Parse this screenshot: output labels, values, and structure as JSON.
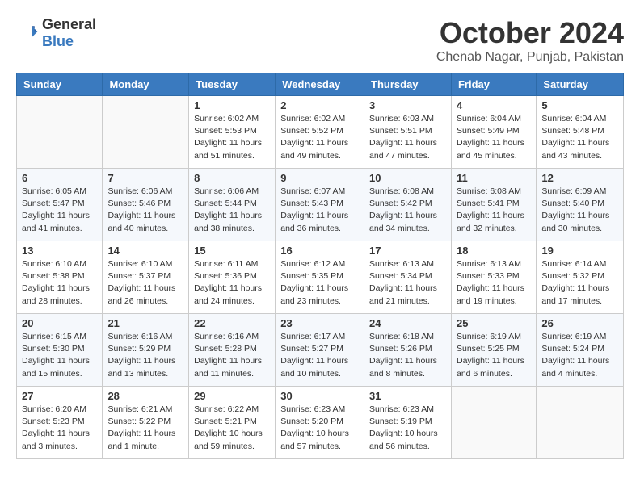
{
  "header": {
    "logo_general": "General",
    "logo_blue": "Blue",
    "month": "October 2024",
    "location": "Chenab Nagar, Punjab, Pakistan"
  },
  "days_of_week": [
    "Sunday",
    "Monday",
    "Tuesday",
    "Wednesday",
    "Thursday",
    "Friday",
    "Saturday"
  ],
  "weeks": [
    [
      {
        "day": "",
        "info": ""
      },
      {
        "day": "",
        "info": ""
      },
      {
        "day": "1",
        "info": "Sunrise: 6:02 AM\nSunset: 5:53 PM\nDaylight: 11 hours and 51 minutes."
      },
      {
        "day": "2",
        "info": "Sunrise: 6:02 AM\nSunset: 5:52 PM\nDaylight: 11 hours and 49 minutes."
      },
      {
        "day": "3",
        "info": "Sunrise: 6:03 AM\nSunset: 5:51 PM\nDaylight: 11 hours and 47 minutes."
      },
      {
        "day": "4",
        "info": "Sunrise: 6:04 AM\nSunset: 5:49 PM\nDaylight: 11 hours and 45 minutes."
      },
      {
        "day": "5",
        "info": "Sunrise: 6:04 AM\nSunset: 5:48 PM\nDaylight: 11 hours and 43 minutes."
      }
    ],
    [
      {
        "day": "6",
        "info": "Sunrise: 6:05 AM\nSunset: 5:47 PM\nDaylight: 11 hours and 41 minutes."
      },
      {
        "day": "7",
        "info": "Sunrise: 6:06 AM\nSunset: 5:46 PM\nDaylight: 11 hours and 40 minutes."
      },
      {
        "day": "8",
        "info": "Sunrise: 6:06 AM\nSunset: 5:44 PM\nDaylight: 11 hours and 38 minutes."
      },
      {
        "day": "9",
        "info": "Sunrise: 6:07 AM\nSunset: 5:43 PM\nDaylight: 11 hours and 36 minutes."
      },
      {
        "day": "10",
        "info": "Sunrise: 6:08 AM\nSunset: 5:42 PM\nDaylight: 11 hours and 34 minutes."
      },
      {
        "day": "11",
        "info": "Sunrise: 6:08 AM\nSunset: 5:41 PM\nDaylight: 11 hours and 32 minutes."
      },
      {
        "day": "12",
        "info": "Sunrise: 6:09 AM\nSunset: 5:40 PM\nDaylight: 11 hours and 30 minutes."
      }
    ],
    [
      {
        "day": "13",
        "info": "Sunrise: 6:10 AM\nSunset: 5:38 PM\nDaylight: 11 hours and 28 minutes."
      },
      {
        "day": "14",
        "info": "Sunrise: 6:10 AM\nSunset: 5:37 PM\nDaylight: 11 hours and 26 minutes."
      },
      {
        "day": "15",
        "info": "Sunrise: 6:11 AM\nSunset: 5:36 PM\nDaylight: 11 hours and 24 minutes."
      },
      {
        "day": "16",
        "info": "Sunrise: 6:12 AM\nSunset: 5:35 PM\nDaylight: 11 hours and 23 minutes."
      },
      {
        "day": "17",
        "info": "Sunrise: 6:13 AM\nSunset: 5:34 PM\nDaylight: 11 hours and 21 minutes."
      },
      {
        "day": "18",
        "info": "Sunrise: 6:13 AM\nSunset: 5:33 PM\nDaylight: 11 hours and 19 minutes."
      },
      {
        "day": "19",
        "info": "Sunrise: 6:14 AM\nSunset: 5:32 PM\nDaylight: 11 hours and 17 minutes."
      }
    ],
    [
      {
        "day": "20",
        "info": "Sunrise: 6:15 AM\nSunset: 5:30 PM\nDaylight: 11 hours and 15 minutes."
      },
      {
        "day": "21",
        "info": "Sunrise: 6:16 AM\nSunset: 5:29 PM\nDaylight: 11 hours and 13 minutes."
      },
      {
        "day": "22",
        "info": "Sunrise: 6:16 AM\nSunset: 5:28 PM\nDaylight: 11 hours and 11 minutes."
      },
      {
        "day": "23",
        "info": "Sunrise: 6:17 AM\nSunset: 5:27 PM\nDaylight: 11 hours and 10 minutes."
      },
      {
        "day": "24",
        "info": "Sunrise: 6:18 AM\nSunset: 5:26 PM\nDaylight: 11 hours and 8 minutes."
      },
      {
        "day": "25",
        "info": "Sunrise: 6:19 AM\nSunset: 5:25 PM\nDaylight: 11 hours and 6 minutes."
      },
      {
        "day": "26",
        "info": "Sunrise: 6:19 AM\nSunset: 5:24 PM\nDaylight: 11 hours and 4 minutes."
      }
    ],
    [
      {
        "day": "27",
        "info": "Sunrise: 6:20 AM\nSunset: 5:23 PM\nDaylight: 11 hours and 3 minutes."
      },
      {
        "day": "28",
        "info": "Sunrise: 6:21 AM\nSunset: 5:22 PM\nDaylight: 11 hours and 1 minute."
      },
      {
        "day": "29",
        "info": "Sunrise: 6:22 AM\nSunset: 5:21 PM\nDaylight: 10 hours and 59 minutes."
      },
      {
        "day": "30",
        "info": "Sunrise: 6:23 AM\nSunset: 5:20 PM\nDaylight: 10 hours and 57 minutes."
      },
      {
        "day": "31",
        "info": "Sunrise: 6:23 AM\nSunset: 5:19 PM\nDaylight: 10 hours and 56 minutes."
      },
      {
        "day": "",
        "info": ""
      },
      {
        "day": "",
        "info": ""
      }
    ]
  ]
}
